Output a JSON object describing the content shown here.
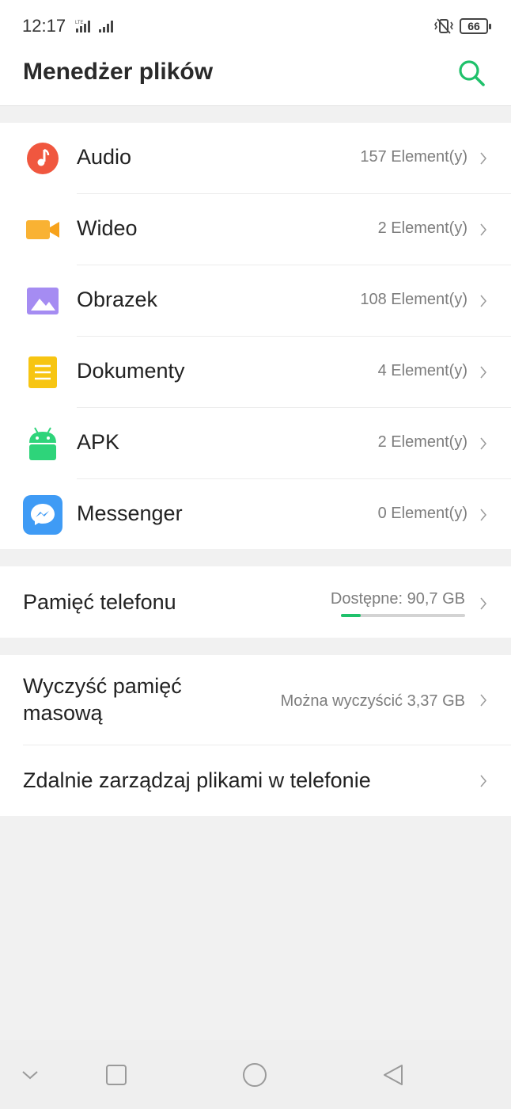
{
  "status_bar": {
    "time": "12:17",
    "network": "LTE",
    "battery": "66"
  },
  "header": {
    "title": "Menedżer plików",
    "search_icon": "search-icon"
  },
  "categories": [
    {
      "label": "Audio",
      "count": "157 Element(y)",
      "icon": "music-note-icon",
      "color": "#f0573f"
    },
    {
      "label": "Wideo",
      "count": "2 Element(y)",
      "icon": "video-camera-icon",
      "color": "#f9b233"
    },
    {
      "label": "Obrazek",
      "count": "108 Element(y)",
      "icon": "image-icon",
      "color": "#9b7ff0"
    },
    {
      "label": "Dokumenty",
      "count": "4 Element(y)",
      "icon": "document-icon",
      "color": "#f7c512"
    },
    {
      "label": "APK",
      "count": "2 Element(y)",
      "icon": "android-icon",
      "color": "#2ed47a"
    },
    {
      "label": "Messenger",
      "count": "0 Element(y)",
      "icon": "messenger-icon",
      "color": "#3f9bf5"
    }
  ],
  "storage": {
    "label": "Pamięć telefonu",
    "available": "Dostępne: 90,7 GB",
    "used_fraction": 0.16
  },
  "tools": {
    "clean_label": "Wyczyść pamięć masową",
    "clean_info": "Można wyczyścić 3,37 GB",
    "remote_label": "Zdalnie zarządzaj plikami w telefonie"
  },
  "nav_bar": {
    "buttons": [
      "chevron-down-icon",
      "recents-square-icon",
      "home-circle-icon",
      "back-triangle-icon"
    ]
  },
  "colors": {
    "accent": "#1fc16b"
  }
}
